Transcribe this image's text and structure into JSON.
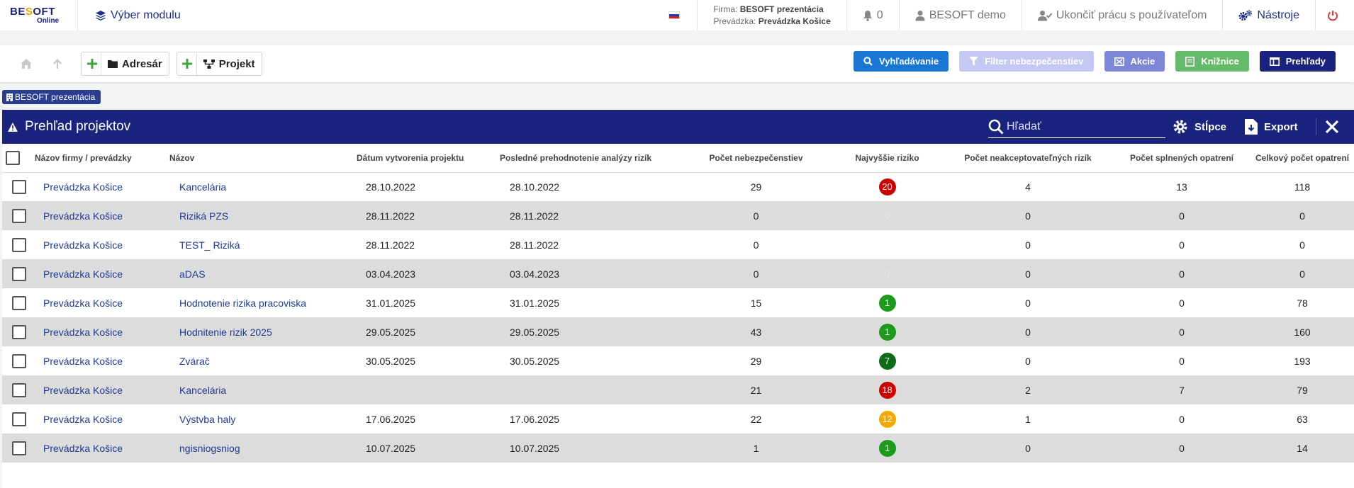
{
  "app": {
    "logo_text_a": "BE",
    "logo_text_b": "S",
    "logo_text_c": "OFT",
    "logo_sub": "Online",
    "module_label": "Výber modulu"
  },
  "header": {
    "firma_label": "Firma:",
    "firma_value": "BESOFT prezentácia",
    "prevadzka_label": "Prevádzka:",
    "prevadzka_value": "Prevádzka Košice",
    "notifications_count": "0",
    "user_label": "BESOFT demo",
    "end_work_label": "Ukončiť prácu s používateľom",
    "tools_label": "Nástroje"
  },
  "toolbar": {
    "adresar_label": "Adresár",
    "projekt_label": "Projekt",
    "buttons": [
      {
        "label": "Vyhľadávanie",
        "color": "#1976d2"
      },
      {
        "label": "Filter nebezpečenstiev",
        "color": "#c5c8f3"
      },
      {
        "label": "Akcie",
        "color": "#7e86d8"
      },
      {
        "label": "Knižnice",
        "color": "#66bb6a"
      },
      {
        "label": "Prehľady",
        "color": "#1a237e"
      }
    ]
  },
  "crumb": {
    "label": "BESOFT prezentácia"
  },
  "panel": {
    "title": "Prehľad projektov",
    "search_placeholder": "Hľadať",
    "columns_label": "Stĺpce",
    "export_label": "Export"
  },
  "table": {
    "headers": [
      "Názov firmy / prevádzky",
      "Názov",
      "Dátum vytvorenia projektu",
      "Posledné prehodnotenie analýzy rizík",
      "Počet nebezpečenstiev",
      "Najvyššie riziko",
      "Počet neakceptovateľných rizík",
      "Počet splnených opatrení",
      "Celkový počet opatrení"
    ],
    "rows": [
      {
        "firma": "Prevádzka Košice",
        "nazov": "Kancelária",
        "datum": "28.10.2022",
        "prehodnotenie": "28.10.2022",
        "nebezpecenstva": "29",
        "riziko": "20",
        "riziko_color": "#cc0000",
        "neakcept": "4",
        "splnene": "13",
        "celkom": "118"
      },
      {
        "firma": "Prevádzka Košice",
        "nazov": "Riziká PZS",
        "datum": "28.11.2022",
        "prehodnotenie": "28.11.2022",
        "nebezpecenstva": "0",
        "riziko": "0",
        "riziko_color": "",
        "neakcept": "0",
        "splnene": "0",
        "celkom": "0"
      },
      {
        "firma": "Prevádzka Košice",
        "nazov": "TEST_ Riziká",
        "datum": "28.11.2022",
        "prehodnotenie": "28.11.2022",
        "nebezpecenstva": "0",
        "riziko": "",
        "riziko_color": "",
        "neakcept": "0",
        "splnene": "0",
        "celkom": "0"
      },
      {
        "firma": "Prevádzka Košice",
        "nazov": "aDAS",
        "datum": "03.04.2023",
        "prehodnotenie": "03.04.2023",
        "nebezpecenstva": "0",
        "riziko": "0",
        "riziko_color": "",
        "neakcept": "0",
        "splnene": "0",
        "celkom": "0"
      },
      {
        "firma": "Prevádzka Košice",
        "nazov": "Hodnotenie rizika pracoviska",
        "datum": "31.01.2025",
        "prehodnotenie": "31.01.2025",
        "nebezpecenstva": "15",
        "riziko": "1",
        "riziko_color": "#1e9b1e",
        "neakcept": "0",
        "splnene": "0",
        "celkom": "78"
      },
      {
        "firma": "Prevádzka Košice",
        "nazov": "Hodnitenie rizik 2025",
        "datum": "29.05.2025",
        "prehodnotenie": "29.05.2025",
        "nebezpecenstva": "43",
        "riziko": "1",
        "riziko_color": "#1e9b1e",
        "neakcept": "0",
        "splnene": "0",
        "celkom": "160"
      },
      {
        "firma": "Prevádzka Košice",
        "nazov": "Zvárač",
        "datum": "30.05.2025",
        "prehodnotenie": "30.05.2025",
        "nebezpecenstva": "29",
        "riziko": "7",
        "riziko_color": "#0e6b16",
        "neakcept": "0",
        "splnene": "0",
        "celkom": "193"
      },
      {
        "firma": "Prevádzka Košice",
        "nazov": "Kancelária",
        "datum": "",
        "prehodnotenie": "",
        "nebezpecenstva": "21",
        "riziko": "18",
        "riziko_color": "#cc0000",
        "neakcept": "2",
        "splnene": "7",
        "celkom": "79"
      },
      {
        "firma": "Prevádzka Košice",
        "nazov": "Výstvba haly",
        "datum": "17.06.2025",
        "prehodnotenie": "17.06.2025",
        "nebezpecenstva": "22",
        "riziko": "12",
        "riziko_color": "#f5a800",
        "neakcept": "1",
        "splnene": "0",
        "celkom": "63"
      },
      {
        "firma": "Prevádzka Košice",
        "nazov": "ngisniogsniog",
        "datum": "10.07.2025",
        "prehodnotenie": "10.07.2025",
        "nebezpecenstva": "1",
        "riziko": "1",
        "riziko_color": "#1e9b1e",
        "neakcept": "0",
        "splnene": "0",
        "celkom": "14"
      }
    ]
  }
}
